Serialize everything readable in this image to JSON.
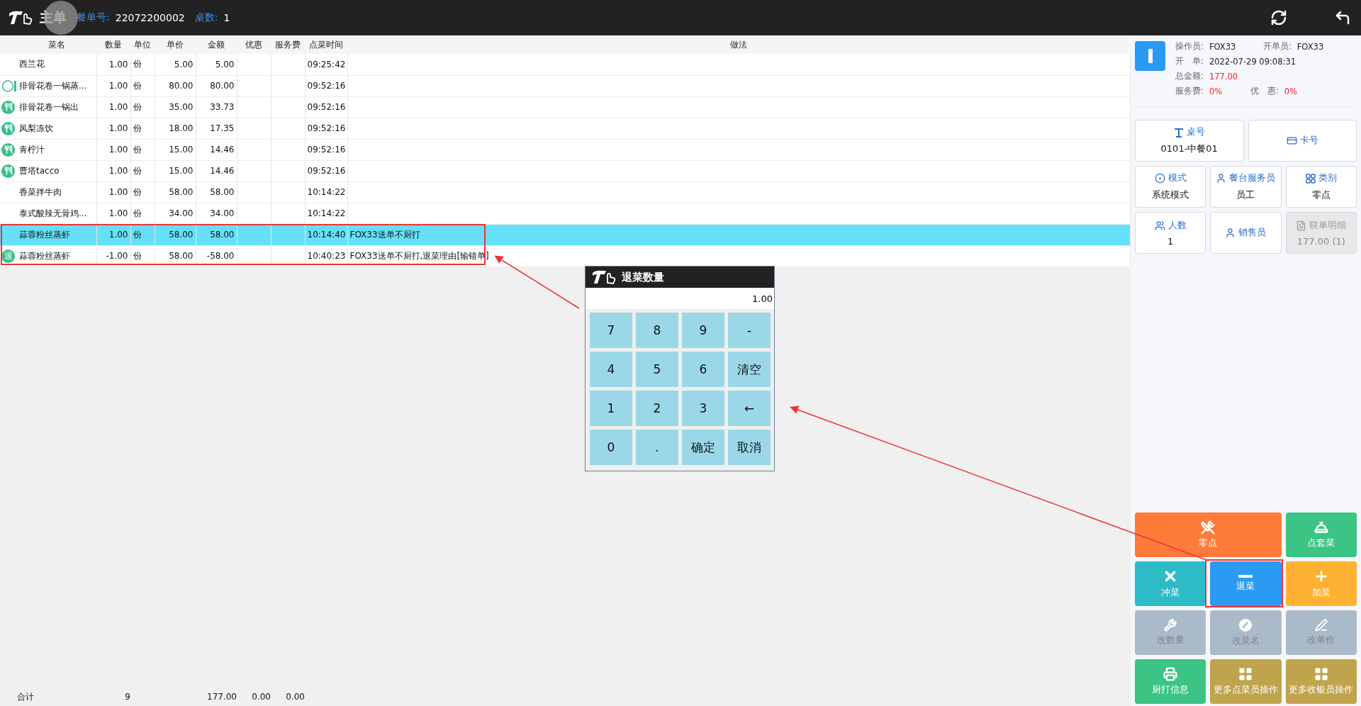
{
  "header": {
    "title": "主单",
    "order_label": "餐单号:",
    "order_no": "22072200002",
    "tables_label": "桌数:",
    "tables": "1"
  },
  "table": {
    "columns": [
      "菜名",
      "数量",
      "单位",
      "单价",
      "金额",
      "优惠",
      "服务费",
      "点菜时间",
      "做法"
    ],
    "rows": [
      {
        "kind": "plain",
        "name": "西兰花",
        "qty": "1.00",
        "unit": "份",
        "price": "5.00",
        "amount": "5.00",
        "time": "09:25:42",
        "selected": false
      },
      {
        "kind": "ring",
        "name": "排骨花卷一锅蒸...",
        "qty": "1.00",
        "unit": "份",
        "price": "80.00",
        "amount": "80.00",
        "time": "09:52:16",
        "selected": false
      },
      {
        "kind": "served",
        "name": "排骨花卷一锅出",
        "qty": "1.00",
        "unit": "份",
        "price": "35.00",
        "amount": "33.73",
        "time": "09:52:16",
        "selected": false
      },
      {
        "kind": "served",
        "name": "凤梨冻饮",
        "qty": "1.00",
        "unit": "份",
        "price": "18.00",
        "amount": "17.35",
        "time": "09:52:16",
        "selected": false
      },
      {
        "kind": "served",
        "name": "青柠汁",
        "qty": "1.00",
        "unit": "份",
        "price": "15.00",
        "amount": "14.46",
        "time": "09:52:16",
        "selected": false
      },
      {
        "kind": "served",
        "name": "曹塔tacco",
        "qty": "1.00",
        "unit": "份",
        "price": "15.00",
        "amount": "14.46",
        "time": "09:52:16",
        "selected": false
      },
      {
        "kind": "plain",
        "name": "香菜拌牛肉",
        "qty": "1.00",
        "unit": "份",
        "price": "58.00",
        "amount": "58.00",
        "time": "10:14:22",
        "selected": false
      },
      {
        "kind": "plain",
        "name": "泰式酸辣无骨鸡...",
        "qty": "1.00",
        "unit": "份",
        "price": "34.00",
        "amount": "34.00",
        "time": "10:14:22",
        "selected": false
      },
      {
        "kind": "plain",
        "name": "蒜蓉粉丝蒸虾",
        "qty": "1.00",
        "unit": "份",
        "price": "58.00",
        "amount": "58.00",
        "time": "10:14:40",
        "method": "FOX33送单不厨打",
        "selected": true
      },
      {
        "kind": "returned",
        "status_text": "退",
        "name": "蒜蓉粉丝蒸虾",
        "qty": "-1.00",
        "unit": "份",
        "price": "58.00",
        "amount": "-58.00",
        "time": "10:40:23",
        "method": "FOX33送单不厨打,退菜理由[输错单]",
        "selected": false
      }
    ]
  },
  "totals": {
    "label": "合计",
    "qty": "9",
    "amount": "177.00",
    "discount": "0.00",
    "service": "0.00"
  },
  "info": {
    "operator_label": "操作员:",
    "operator": "FOX33",
    "opener_label": "开单员:",
    "opener": "FOX33",
    "open_label": "开　单:",
    "open_time": "2022-07-29 09:08:31",
    "total_label": "总金额:",
    "total": "177.00",
    "service_label": "服务费:",
    "service": "0%",
    "discount_label": "优　惠:",
    "discount": "0%"
  },
  "tiles": [
    {
      "label": "桌号",
      "value": "0101-中餐01",
      "disabled": false
    },
    {
      "label": "卡号",
      "disabled": false
    },
    {
      "label": "模式",
      "value": "系统模式",
      "disabled": false
    },
    {
      "label": "餐台服务员",
      "value": "员工",
      "disabled": false
    },
    {
      "label": "类别",
      "value": "零点",
      "disabled": false
    },
    {
      "label": "人数",
      "value": "1",
      "disabled": false
    },
    {
      "label": "销售员",
      "disabled": false
    },
    {
      "label": "联单明细",
      "value": "177.00 (1)",
      "disabled": true
    }
  ],
  "actions": [
    {
      "label": "零点",
      "color": "#ff7b3a",
      "wide": true,
      "disabled": false
    },
    {
      "label": "点套菜",
      "color": "#3bc484",
      "wide": false,
      "disabled": false
    },
    {
      "label": "冲菜",
      "color": "#2ebbc8",
      "wide": false,
      "disabled": false
    },
    {
      "label": "退菜",
      "color": "#2b9af3",
      "wide": false,
      "disabled": false
    },
    {
      "label": "加菜",
      "color": "#ffb133",
      "wide": false,
      "disabled": false
    },
    {
      "label": "改数量",
      "color": "#abbac9",
      "wide": false,
      "disabled": true
    },
    {
      "label": "改菜名",
      "color": "#abbac9",
      "wide": false,
      "disabled": true
    },
    {
      "label": "改单价",
      "color": "#abbac9",
      "wide": false,
      "disabled": true
    },
    {
      "label": "厨打信息",
      "color": "#3bc484",
      "wide": false,
      "disabled": false
    },
    {
      "label": "更多点菜员操作",
      "color": "#bfa34d",
      "wide": false,
      "disabled": false
    },
    {
      "label": "更多收银员操作",
      "color": "#bfa34d",
      "wide": false,
      "disabled": false
    }
  ],
  "dialog": {
    "title": "退菜数量",
    "value": "1.00",
    "keys": [
      "7",
      "8",
      "9",
      "-",
      "4",
      "5",
      "6",
      "清空",
      "1",
      "2",
      "3",
      "←",
      "0",
      ".",
      "确定",
      "取消"
    ]
  }
}
